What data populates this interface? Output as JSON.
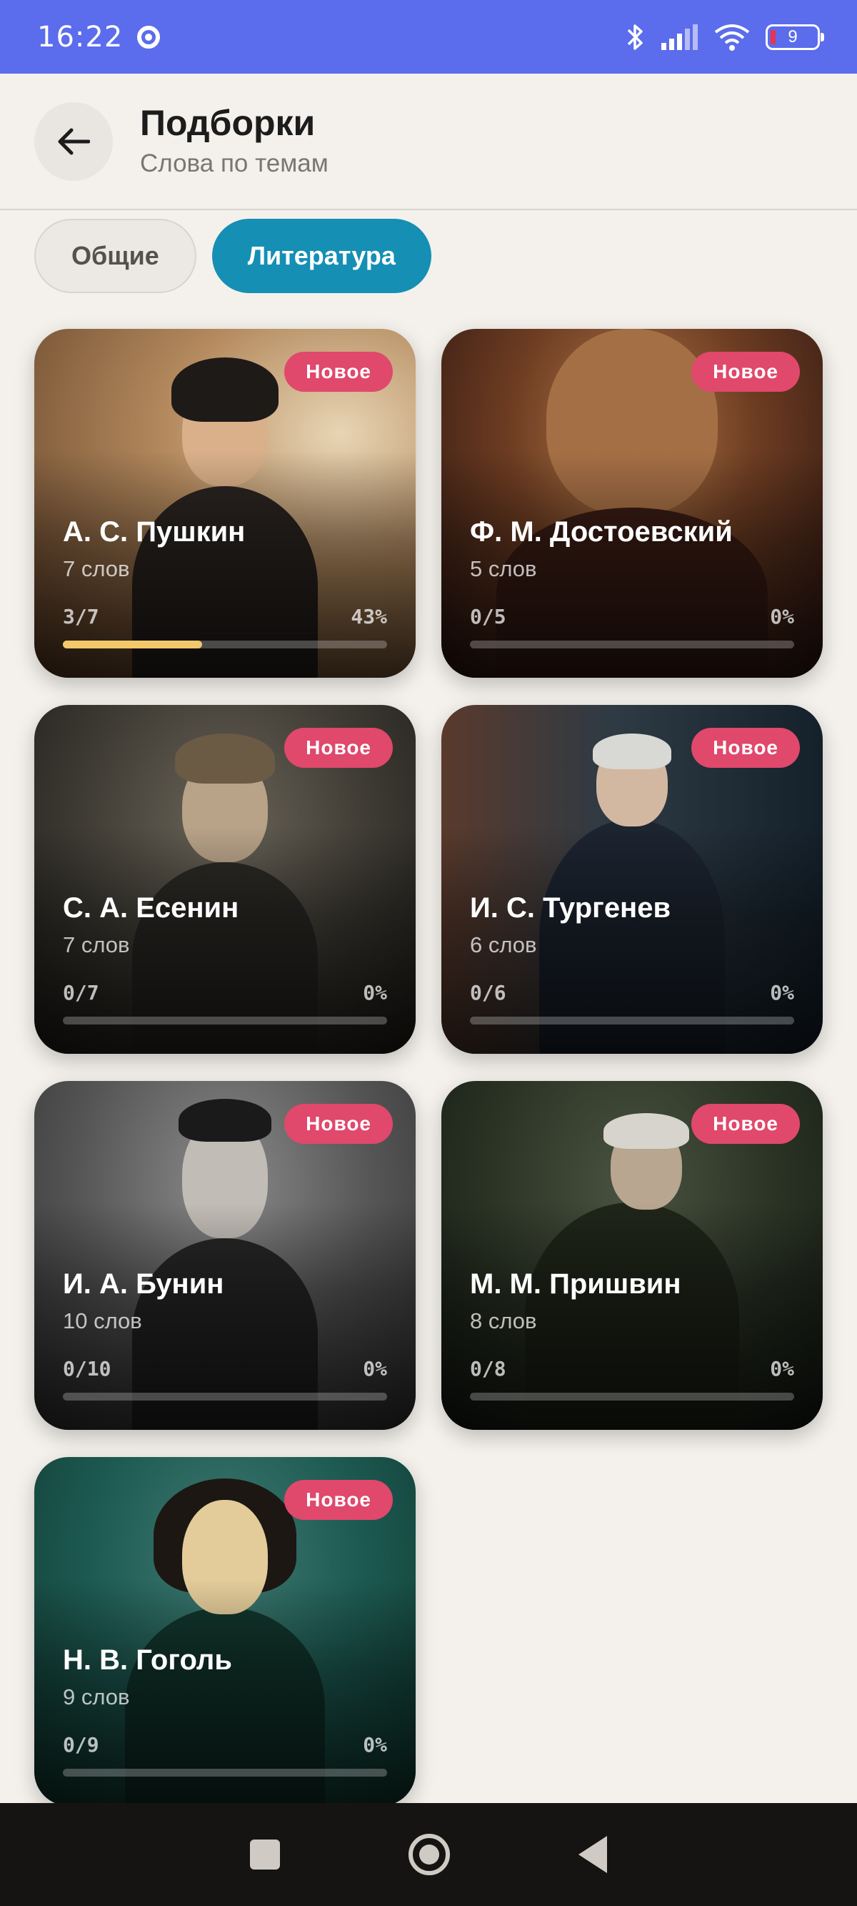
{
  "status_bar": {
    "time": "16:22",
    "battery": "9",
    "icons": [
      "chrome-icon",
      "bluetooth-icon",
      "signal-icon",
      "wifi-icon",
      "battery-icon"
    ]
  },
  "header": {
    "title": "Подборки",
    "subtitle": "Слова по темам"
  },
  "tabs": [
    {
      "label": "Общие",
      "active": false
    },
    {
      "label": "Литература",
      "active": true
    }
  ],
  "cards": [
    {
      "title": "А. С. Пушкин",
      "count": "7 слов",
      "progress": "3/7",
      "percent": "43%",
      "progress_fraction": 0.43,
      "badge": "Новое"
    },
    {
      "title": "Ф. М. Достоевский",
      "count": "5 слов",
      "progress": "0/5",
      "percent": "0%",
      "progress_fraction": 0,
      "badge": "Новое"
    },
    {
      "title": "С. А. Есенин",
      "count": "7 слов",
      "progress": "0/7",
      "percent": "0%",
      "progress_fraction": 0,
      "badge": "Новое"
    },
    {
      "title": "И. С. Тургенев",
      "count": "6 слов",
      "progress": "0/6",
      "percent": "0%",
      "progress_fraction": 0,
      "badge": "Новое"
    },
    {
      "title": "И. А. Бунин",
      "count": "10 слов",
      "progress": "0/10",
      "percent": "0%",
      "progress_fraction": 0,
      "badge": "Новое"
    },
    {
      "title": "М. М. Пришвин",
      "count": "8 слов",
      "progress": "0/8",
      "percent": "0%",
      "progress_fraction": 0,
      "badge": "Новое"
    },
    {
      "title": "Н. В. Гоголь",
      "count": "9 слов",
      "progress": "0/9",
      "percent": "0%",
      "progress_fraction": 0,
      "badge": "Новое"
    }
  ],
  "colors": {
    "status_bar": "#5b6cec",
    "active_tab": "#158fb4",
    "badge": "#e0486c",
    "progress_fill": "#f2c86b",
    "background": "#f4f1ec"
  },
  "nav_bar": {
    "icons": [
      "recents-icon",
      "home-icon",
      "back-icon"
    ]
  }
}
